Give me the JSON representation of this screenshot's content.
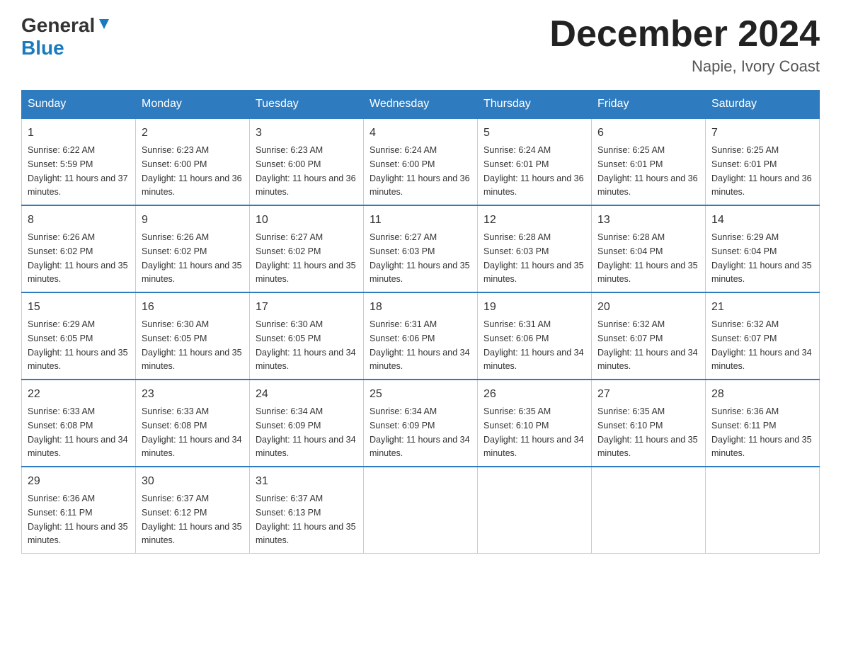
{
  "header": {
    "logo_general": "General",
    "logo_blue": "Blue",
    "month_title": "December 2024",
    "location": "Napie, Ivory Coast"
  },
  "days_of_week": [
    "Sunday",
    "Monday",
    "Tuesday",
    "Wednesday",
    "Thursday",
    "Friday",
    "Saturday"
  ],
  "weeks": [
    [
      {
        "day": "1",
        "sunrise": "6:22 AM",
        "sunset": "5:59 PM",
        "daylight": "11 hours and 37 minutes."
      },
      {
        "day": "2",
        "sunrise": "6:23 AM",
        "sunset": "6:00 PM",
        "daylight": "11 hours and 36 minutes."
      },
      {
        "day": "3",
        "sunrise": "6:23 AM",
        "sunset": "6:00 PM",
        "daylight": "11 hours and 36 minutes."
      },
      {
        "day": "4",
        "sunrise": "6:24 AM",
        "sunset": "6:00 PM",
        "daylight": "11 hours and 36 minutes."
      },
      {
        "day": "5",
        "sunrise": "6:24 AM",
        "sunset": "6:01 PM",
        "daylight": "11 hours and 36 minutes."
      },
      {
        "day": "6",
        "sunrise": "6:25 AM",
        "sunset": "6:01 PM",
        "daylight": "11 hours and 36 minutes."
      },
      {
        "day": "7",
        "sunrise": "6:25 AM",
        "sunset": "6:01 PM",
        "daylight": "11 hours and 36 minutes."
      }
    ],
    [
      {
        "day": "8",
        "sunrise": "6:26 AM",
        "sunset": "6:02 PM",
        "daylight": "11 hours and 35 minutes."
      },
      {
        "day": "9",
        "sunrise": "6:26 AM",
        "sunset": "6:02 PM",
        "daylight": "11 hours and 35 minutes."
      },
      {
        "day": "10",
        "sunrise": "6:27 AM",
        "sunset": "6:02 PM",
        "daylight": "11 hours and 35 minutes."
      },
      {
        "day": "11",
        "sunrise": "6:27 AM",
        "sunset": "6:03 PM",
        "daylight": "11 hours and 35 minutes."
      },
      {
        "day": "12",
        "sunrise": "6:28 AM",
        "sunset": "6:03 PM",
        "daylight": "11 hours and 35 minutes."
      },
      {
        "day": "13",
        "sunrise": "6:28 AM",
        "sunset": "6:04 PM",
        "daylight": "11 hours and 35 minutes."
      },
      {
        "day": "14",
        "sunrise": "6:29 AM",
        "sunset": "6:04 PM",
        "daylight": "11 hours and 35 minutes."
      }
    ],
    [
      {
        "day": "15",
        "sunrise": "6:29 AM",
        "sunset": "6:05 PM",
        "daylight": "11 hours and 35 minutes."
      },
      {
        "day": "16",
        "sunrise": "6:30 AM",
        "sunset": "6:05 PM",
        "daylight": "11 hours and 35 minutes."
      },
      {
        "day": "17",
        "sunrise": "6:30 AM",
        "sunset": "6:05 PM",
        "daylight": "11 hours and 34 minutes."
      },
      {
        "day": "18",
        "sunrise": "6:31 AM",
        "sunset": "6:06 PM",
        "daylight": "11 hours and 34 minutes."
      },
      {
        "day": "19",
        "sunrise": "6:31 AM",
        "sunset": "6:06 PM",
        "daylight": "11 hours and 34 minutes."
      },
      {
        "day": "20",
        "sunrise": "6:32 AM",
        "sunset": "6:07 PM",
        "daylight": "11 hours and 34 minutes."
      },
      {
        "day": "21",
        "sunrise": "6:32 AM",
        "sunset": "6:07 PM",
        "daylight": "11 hours and 34 minutes."
      }
    ],
    [
      {
        "day": "22",
        "sunrise": "6:33 AM",
        "sunset": "6:08 PM",
        "daylight": "11 hours and 34 minutes."
      },
      {
        "day": "23",
        "sunrise": "6:33 AM",
        "sunset": "6:08 PM",
        "daylight": "11 hours and 34 minutes."
      },
      {
        "day": "24",
        "sunrise": "6:34 AM",
        "sunset": "6:09 PM",
        "daylight": "11 hours and 34 minutes."
      },
      {
        "day": "25",
        "sunrise": "6:34 AM",
        "sunset": "6:09 PM",
        "daylight": "11 hours and 34 minutes."
      },
      {
        "day": "26",
        "sunrise": "6:35 AM",
        "sunset": "6:10 PM",
        "daylight": "11 hours and 34 minutes."
      },
      {
        "day": "27",
        "sunrise": "6:35 AM",
        "sunset": "6:10 PM",
        "daylight": "11 hours and 35 minutes."
      },
      {
        "day": "28",
        "sunrise": "6:36 AM",
        "sunset": "6:11 PM",
        "daylight": "11 hours and 35 minutes."
      }
    ],
    [
      {
        "day": "29",
        "sunrise": "6:36 AM",
        "sunset": "6:11 PM",
        "daylight": "11 hours and 35 minutes."
      },
      {
        "day": "30",
        "sunrise": "6:37 AM",
        "sunset": "6:12 PM",
        "daylight": "11 hours and 35 minutes."
      },
      {
        "day": "31",
        "sunrise": "6:37 AM",
        "sunset": "6:13 PM",
        "daylight": "11 hours and 35 minutes."
      },
      null,
      null,
      null,
      null
    ]
  ],
  "labels": {
    "sunrise_prefix": "Sunrise: ",
    "sunset_prefix": "Sunset: ",
    "daylight_prefix": "Daylight: "
  }
}
